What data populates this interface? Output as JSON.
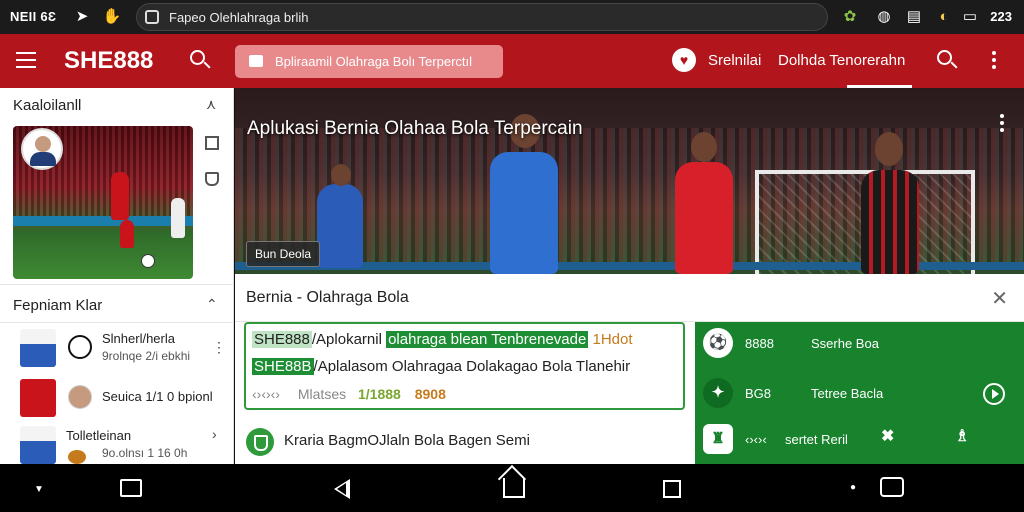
{
  "status_bar": {
    "left_text": "NEII 6Ɛ",
    "url": "Fapeo Olehlahraga brlih",
    "right_text": "223",
    "icons": [
      "send-icon",
      "hand-icon",
      "android-icon",
      "chat-bubble-icon",
      "clipboard-icon",
      "sound-icon",
      "battery-icon"
    ]
  },
  "app_bar": {
    "brand": "SHE888",
    "pill_text": "Bpliraamil Olahraga Bolı Terperctıl",
    "nav": [
      "Srelnilai",
      "Dolhda Tenorerahn"
    ],
    "accent_color": "#b3151c"
  },
  "sidebar": {
    "section1_title": "Kaaloilanll",
    "section2_title": "Fepniam Klar",
    "items": [
      {
        "title": "Slnherl/herla",
        "subtitle": "9rolnqe 2/i ebkhi"
      },
      {
        "title": "Seuica 1/1 0 bpionl",
        "subtitle": ""
      },
      {
        "title": "Tolletleinan",
        "subtitle": "9o.olnsı 1 16 0h"
      }
    ]
  },
  "hero": {
    "title": "Aplukasi Bernia Olahaa Bola Terpercain",
    "badge": "Bun Deola"
  },
  "card": {
    "title": "Bernia - Olahraga Bola",
    "line1_a": "SHE888",
    "line1_b": "/Aplokarnil",
    "line1_c": "olahraga blean Tenbrenevade",
    "line1_d": "1Hdot",
    "line2_a": "SHE88B",
    "line2_b": "/Aplalasom Olahragaa Dolakagao Bola Tlanehir",
    "line3_a": "‹›‹›‹›",
    "line3_b": "Mlatses",
    "line3_c": "1/1888",
    "line3_d": "8908",
    "bottom_row": "Kraria BagmOJlaln Bola Bagen Semi"
  },
  "green_panel": {
    "items": [
      {
        "code": "8888",
        "label": "Sserhe Boa"
      },
      {
        "code": "BG8",
        "label": "Tetree Bacla"
      },
      {
        "code": "‹›‹›‹",
        "label": "sertet Reril"
      }
    ],
    "color": "#18832c"
  }
}
